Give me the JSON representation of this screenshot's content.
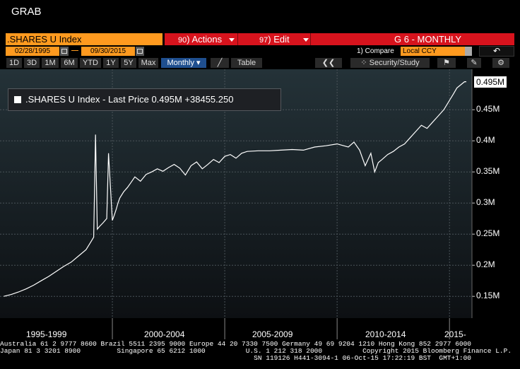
{
  "window": {
    "title": "GRAB"
  },
  "toolbar": {
    "ticker": ".SHARES U Index",
    "actions": {
      "num": "90",
      "label": "Actions"
    },
    "edit": {
      "num": "97",
      "label": "Edit"
    },
    "chart_name": "G 6 - MONTHLY",
    "start_date": "02/28/1995",
    "end_date": "09/30/2015",
    "compare_label": "1) Compare",
    "currency": "Local CCY",
    "periods": [
      "1D",
      "3D",
      "1M",
      "6M",
      "YTD",
      "1Y",
      "5Y",
      "Max"
    ],
    "frequency": "Monthly",
    "table_label": "Table",
    "security_study": "Security/Study"
  },
  "legend": {
    "text": ".SHARES U Index - Last Price 0.495M  +38455.250"
  },
  "last_price_tag": "0.495M",
  "colors": {
    "accent_orange": "#ff9a1f",
    "accent_red": "#d7131d",
    "active_blue": "#1f4f8f"
  },
  "chart_data": {
    "type": "line",
    "series": [
      {
        "name": ".SHARES U Index - Last Price",
        "values": []
      }
    ],
    "x": [
      1995.17,
      1995.5,
      1995.83,
      1996.17,
      1996.5,
      1996.83,
      1997.17,
      1997.5,
      1997.83,
      1998.17,
      1998.5,
      1998.83,
      1999.0,
      1999.17,
      1999.25,
      1999.33,
      1999.42,
      1999.58,
      1999.75,
      1999.83,
      2000.0,
      2000.08,
      2000.17,
      2000.25,
      2000.33,
      2000.5,
      2000.67,
      2000.83,
      2001.0,
      2001.25,
      2001.5,
      2001.75,
      2002.0,
      2002.25,
      2002.5,
      2002.75,
      2003.0,
      2003.25,
      2003.5,
      2003.75,
      2004.0,
      2004.25,
      2004.5,
      2004.75,
      2005.0,
      2005.25,
      2005.5,
      2005.75,
      2006.0,
      2006.5,
      2007.0,
      2007.5,
      2008.0,
      2008.5,
      2009.0,
      2009.5,
      2010.0,
      2010.5,
      2010.75,
      2011.0,
      2011.25,
      2011.5,
      2011.67,
      2011.83,
      2012.0,
      2012.25,
      2012.5,
      2012.75,
      2013.0,
      2013.25,
      2013.5,
      2013.75,
      2014.0,
      2014.25,
      2014.5,
      2014.75,
      2015.0,
      2015.17,
      2015.33,
      2015.5,
      2015.67,
      2015.75
    ],
    "y": [
      0.15,
      0.153,
      0.157,
      0.162,
      0.168,
      0.175,
      0.182,
      0.19,
      0.198,
      0.205,
      0.215,
      0.225,
      0.235,
      0.245,
      0.41,
      0.258,
      0.262,
      0.268,
      0.275,
      0.38,
      0.272,
      0.28,
      0.29,
      0.3,
      0.308,
      0.318,
      0.325,
      0.333,
      0.342,
      0.335,
      0.346,
      0.35,
      0.355,
      0.351,
      0.357,
      0.362,
      0.356,
      0.345,
      0.36,
      0.366,
      0.355,
      0.362,
      0.37,
      0.365,
      0.375,
      0.378,
      0.372,
      0.38,
      0.383,
      0.384,
      0.384,
      0.385,
      0.386,
      0.385,
      0.39,
      0.392,
      0.395,
      0.39,
      0.398,
      0.385,
      0.36,
      0.38,
      0.35,
      0.365,
      0.37,
      0.378,
      0.383,
      0.39,
      0.395,
      0.405,
      0.415,
      0.425,
      0.42,
      0.43,
      0.44,
      0.45,
      0.465,
      0.475,
      0.485,
      0.49,
      0.495,
      0.495
    ],
    "yticks": [
      "0.15M",
      "0.2M",
      "0.25M",
      "0.3M",
      "0.35M",
      "0.4M",
      "0.45M"
    ],
    "ytick_values": [
      0.15,
      0.2,
      0.25,
      0.3,
      0.35,
      0.4,
      0.45
    ],
    "xticks": [
      "1995-1999",
      "2000-2004",
      "2005-2009",
      "2010-2014",
      "2015-"
    ],
    "xlim": [
      1995.0,
      2016.0
    ],
    "ylim": [
      0.115,
      0.515
    ],
    "grid": true,
    "legend": "top-left"
  },
  "footer": {
    "line1": "Australia 61 2 9777 8600 Brazil 5511 2395 9000 Europe 44 20 7330 7500 Germany 49 69 9204 1210 Hong Kong 852 2977 6000",
    "line2": "Japan 81 3 3201 8900         Singapore 65 6212 1000          U.S. 1 212 318 2000          Copyright 2015 Bloomberg Finance L.P.",
    "line3": "                                                               SN 119126 H441-3094-1 06-Oct-15 17:22:19 BST  GMT+1:00"
  }
}
